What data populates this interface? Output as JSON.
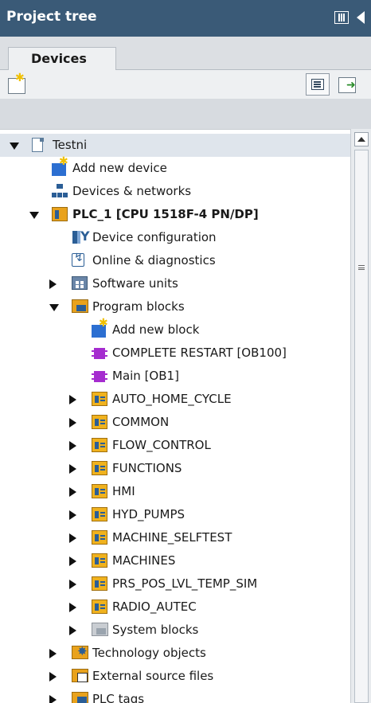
{
  "panel": {
    "title": "Project tree"
  },
  "tabs": [
    {
      "label": "Devices"
    }
  ],
  "tree": [
    {
      "label": "Testni",
      "icon": "document-icon",
      "expander": "open",
      "bold": false
    },
    {
      "label": "Add new device",
      "icon": "add-new-icon",
      "expander": "none",
      "bold": false
    },
    {
      "label": "Devices & networks",
      "icon": "network-icon",
      "expander": "none",
      "bold": false
    },
    {
      "label": "PLC_1 [CPU 1518F-4 PN/DP]",
      "icon": "plc-icon",
      "expander": "open",
      "bold": true
    },
    {
      "label": "Device configuration",
      "icon": "device-config-icon",
      "expander": "none",
      "bold": false
    },
    {
      "label": "Online & diagnostics",
      "icon": "diagnostics-icon",
      "expander": "none",
      "bold": false
    },
    {
      "label": "Software units",
      "icon": "software-units-icon",
      "expander": "closed",
      "bold": false
    },
    {
      "label": "Program blocks",
      "icon": "program-blocks-icon",
      "expander": "open",
      "bold": false
    },
    {
      "label": "Add new block",
      "icon": "add-new-icon",
      "expander": "none",
      "bold": false
    },
    {
      "label": "COMPLETE RESTART [OB100]",
      "icon": "ob-block-icon",
      "expander": "none",
      "bold": false
    },
    {
      "label": "Main [OB1]",
      "icon": "ob-block-icon",
      "expander": "none",
      "bold": false
    },
    {
      "label": "AUTO_HOME_CYCLE",
      "icon": "block-group-icon",
      "expander": "closed",
      "bold": false
    },
    {
      "label": "COMMON",
      "icon": "block-group-icon",
      "expander": "closed",
      "bold": false
    },
    {
      "label": "FLOW_CONTROL",
      "icon": "block-group-icon",
      "expander": "closed",
      "bold": false
    },
    {
      "label": "FUNCTIONS",
      "icon": "block-group-icon",
      "expander": "closed",
      "bold": false
    },
    {
      "label": "HMI",
      "icon": "block-group-icon",
      "expander": "closed",
      "bold": false
    },
    {
      "label": "HYD_PUMPS",
      "icon": "block-group-icon",
      "expander": "closed",
      "bold": false
    },
    {
      "label": "MACHINE_SELFTEST",
      "icon": "block-group-icon",
      "expander": "closed",
      "bold": false
    },
    {
      "label": "MACHINES",
      "icon": "block-group-icon",
      "expander": "closed",
      "bold": false
    },
    {
      "label": "PRS_POS_LVL_TEMP_SIM",
      "icon": "block-group-icon",
      "expander": "closed",
      "bold": false
    },
    {
      "label": "RADIO_AUTEC",
      "icon": "block-group-icon",
      "expander": "closed",
      "bold": false
    },
    {
      "label": "System blocks",
      "icon": "system-blocks-icon",
      "expander": "closed",
      "bold": false
    },
    {
      "label": "Technology objects",
      "icon": "technology-objects-icon",
      "expander": "closed",
      "bold": false
    },
    {
      "label": "External source files",
      "icon": "external-source-icon",
      "expander": "closed",
      "bold": false
    },
    {
      "label": "PLC tags",
      "icon": "plc-tags-icon",
      "expander": "closed",
      "bold": false
    }
  ],
  "colors": {
    "titlebar": "#3a5a77",
    "selected_row": "#dfe5ec"
  }
}
